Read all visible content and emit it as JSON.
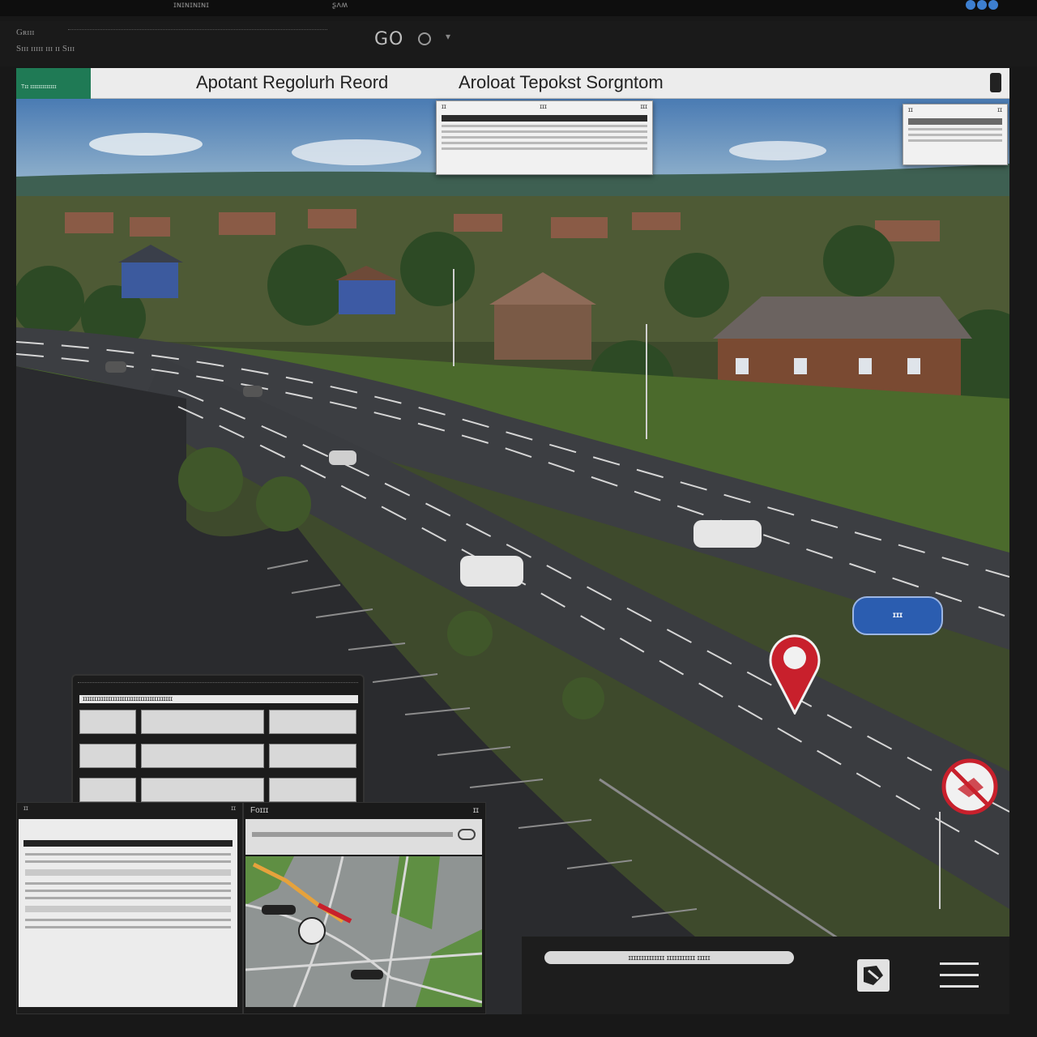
{
  "system_bar": {
    "left_text": "ɪɴɪɴɪɴɪɴɪ",
    "right_text": "ʂʌʍ"
  },
  "address": {
    "line1": "Gʀɪɪɪ",
    "line2": "Sɪɪɪ ɪɪɪɪɪ  ɪɪɪ  ɪɪ  Sɪɪɪ",
    "go_label": "GO"
  },
  "header": {
    "brand_text": "Tɪɪ ɪɪɪɪɪɪɪɪɪɪɪɪɪ",
    "title_left": "Apotant Regolurh Reord",
    "title_right": "Aroloat Tepokst Sorgntom"
  },
  "cards": {
    "top_center": {
      "left": "ɪɪ",
      "mid": "ɪɪɪ",
      "right": "ɪɪɪ"
    },
    "top_right": {
      "left": "ɪɪ",
      "right": "ɪɪ"
    }
  },
  "table_card": {
    "title": "ɪɪɪɪɪɪɪɪɪɪɪɪɪɪɪɪɪɪɪɪɪɪɪɪɪɪɪɪɪɪɪɪɪɪɪɪɪɪɪ"
  },
  "doc_window": {
    "left": "ɪɪ",
    "right": "ɪɪ"
  },
  "map_window": {
    "label": "Foɪɪɪ",
    "right": "ɪɪ"
  },
  "bottom_bar": {
    "search_text": "ɪɪɪɪɪɪɪɪɪɪɪɪɪɪ ɪɪɪɪɪɪɪɪɪɪɪ ɪɪɪɪɪ"
  },
  "markers": {
    "road_sign": "ɪɪɪ"
  },
  "colors": {
    "brand": "#1f7a55",
    "sign_blue": "#2b5db0",
    "pin_red": "#c8202c",
    "asphalt": "#333639"
  }
}
